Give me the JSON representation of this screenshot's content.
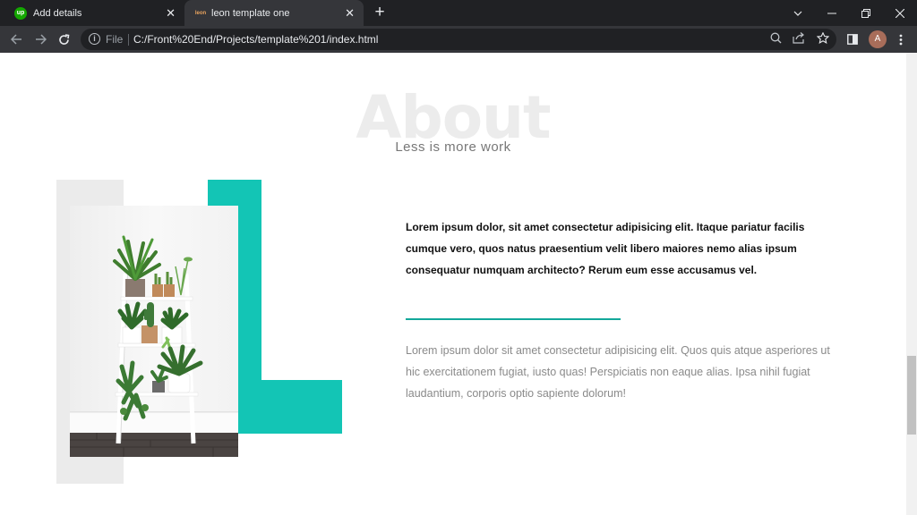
{
  "browser": {
    "tabs": [
      {
        "favicon": "upwork-icon",
        "favicon_text": "up",
        "title": "Add details",
        "active": false
      },
      {
        "favicon": "template-icon",
        "favicon_text": "leon",
        "title": "leon template one",
        "active": true
      }
    ],
    "protocol_label": "File",
    "url": "C:/Front%20End/Projects/template%201/index.html",
    "avatar_letter": "A"
  },
  "page": {
    "heading": "About",
    "subheading": "Less is more work",
    "lead_paragraph": "Lorem ipsum dolor, sit amet consectetur adipisicing elit. Itaque pariatur facilis cumque vero, quos natus praesentium velit libero maiores nemo alias ipsum consequatur numquam architecto? Rerum eum esse accusamus vel.",
    "body_paragraph": "Lorem ipsum dolor sit amet consectetur adipisicing elit. Quos quis atque asperiores ut hic exercitationem fugiat, iusto quas! Perspiciatis non eaque alias. Ipsa nihil fugiat laudantium, corporis optio sapiente dolorum!"
  },
  "colors": {
    "accent": "#13c5b5",
    "divider": "#13a89a",
    "heading_watermark": "#ececec",
    "tab_bar": "#202124",
    "toolbar": "#35363a"
  }
}
